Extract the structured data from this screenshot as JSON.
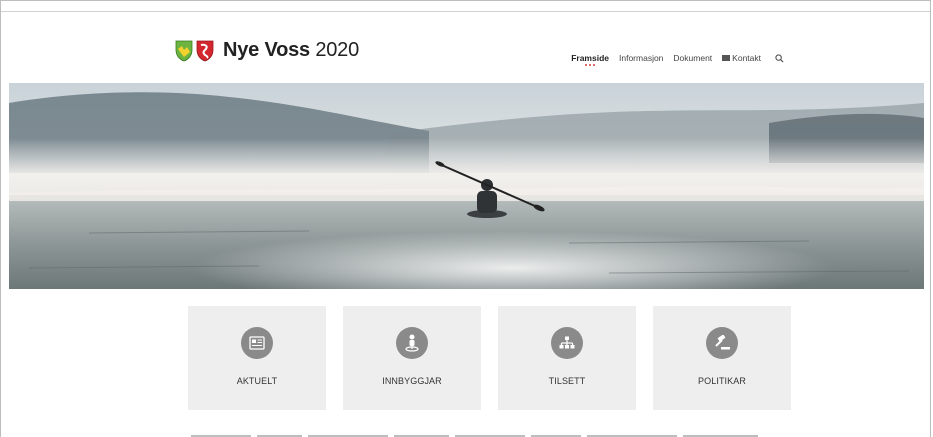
{
  "brand": {
    "name_bold": "Nye Voss",
    "name_year": " 2020"
  },
  "nav": {
    "items": [
      "Framside",
      "Informasjon",
      "Dokument",
      "Kontakt"
    ],
    "active": "Framside"
  },
  "tiles": [
    {
      "label": "AKTUELT",
      "icon": "newspaper-icon"
    },
    {
      "label": "INNBYGGJAR",
      "icon": "person-pin-icon"
    },
    {
      "label": "TILSETT",
      "icon": "org-chart-icon"
    },
    {
      "label": "POLITIKAR",
      "icon": "gavel-icon"
    }
  ],
  "colors": {
    "tile_bg": "#eeeeee",
    "icon_circle": "#8a8a8a",
    "nav_dot": "#d23a3a"
  }
}
